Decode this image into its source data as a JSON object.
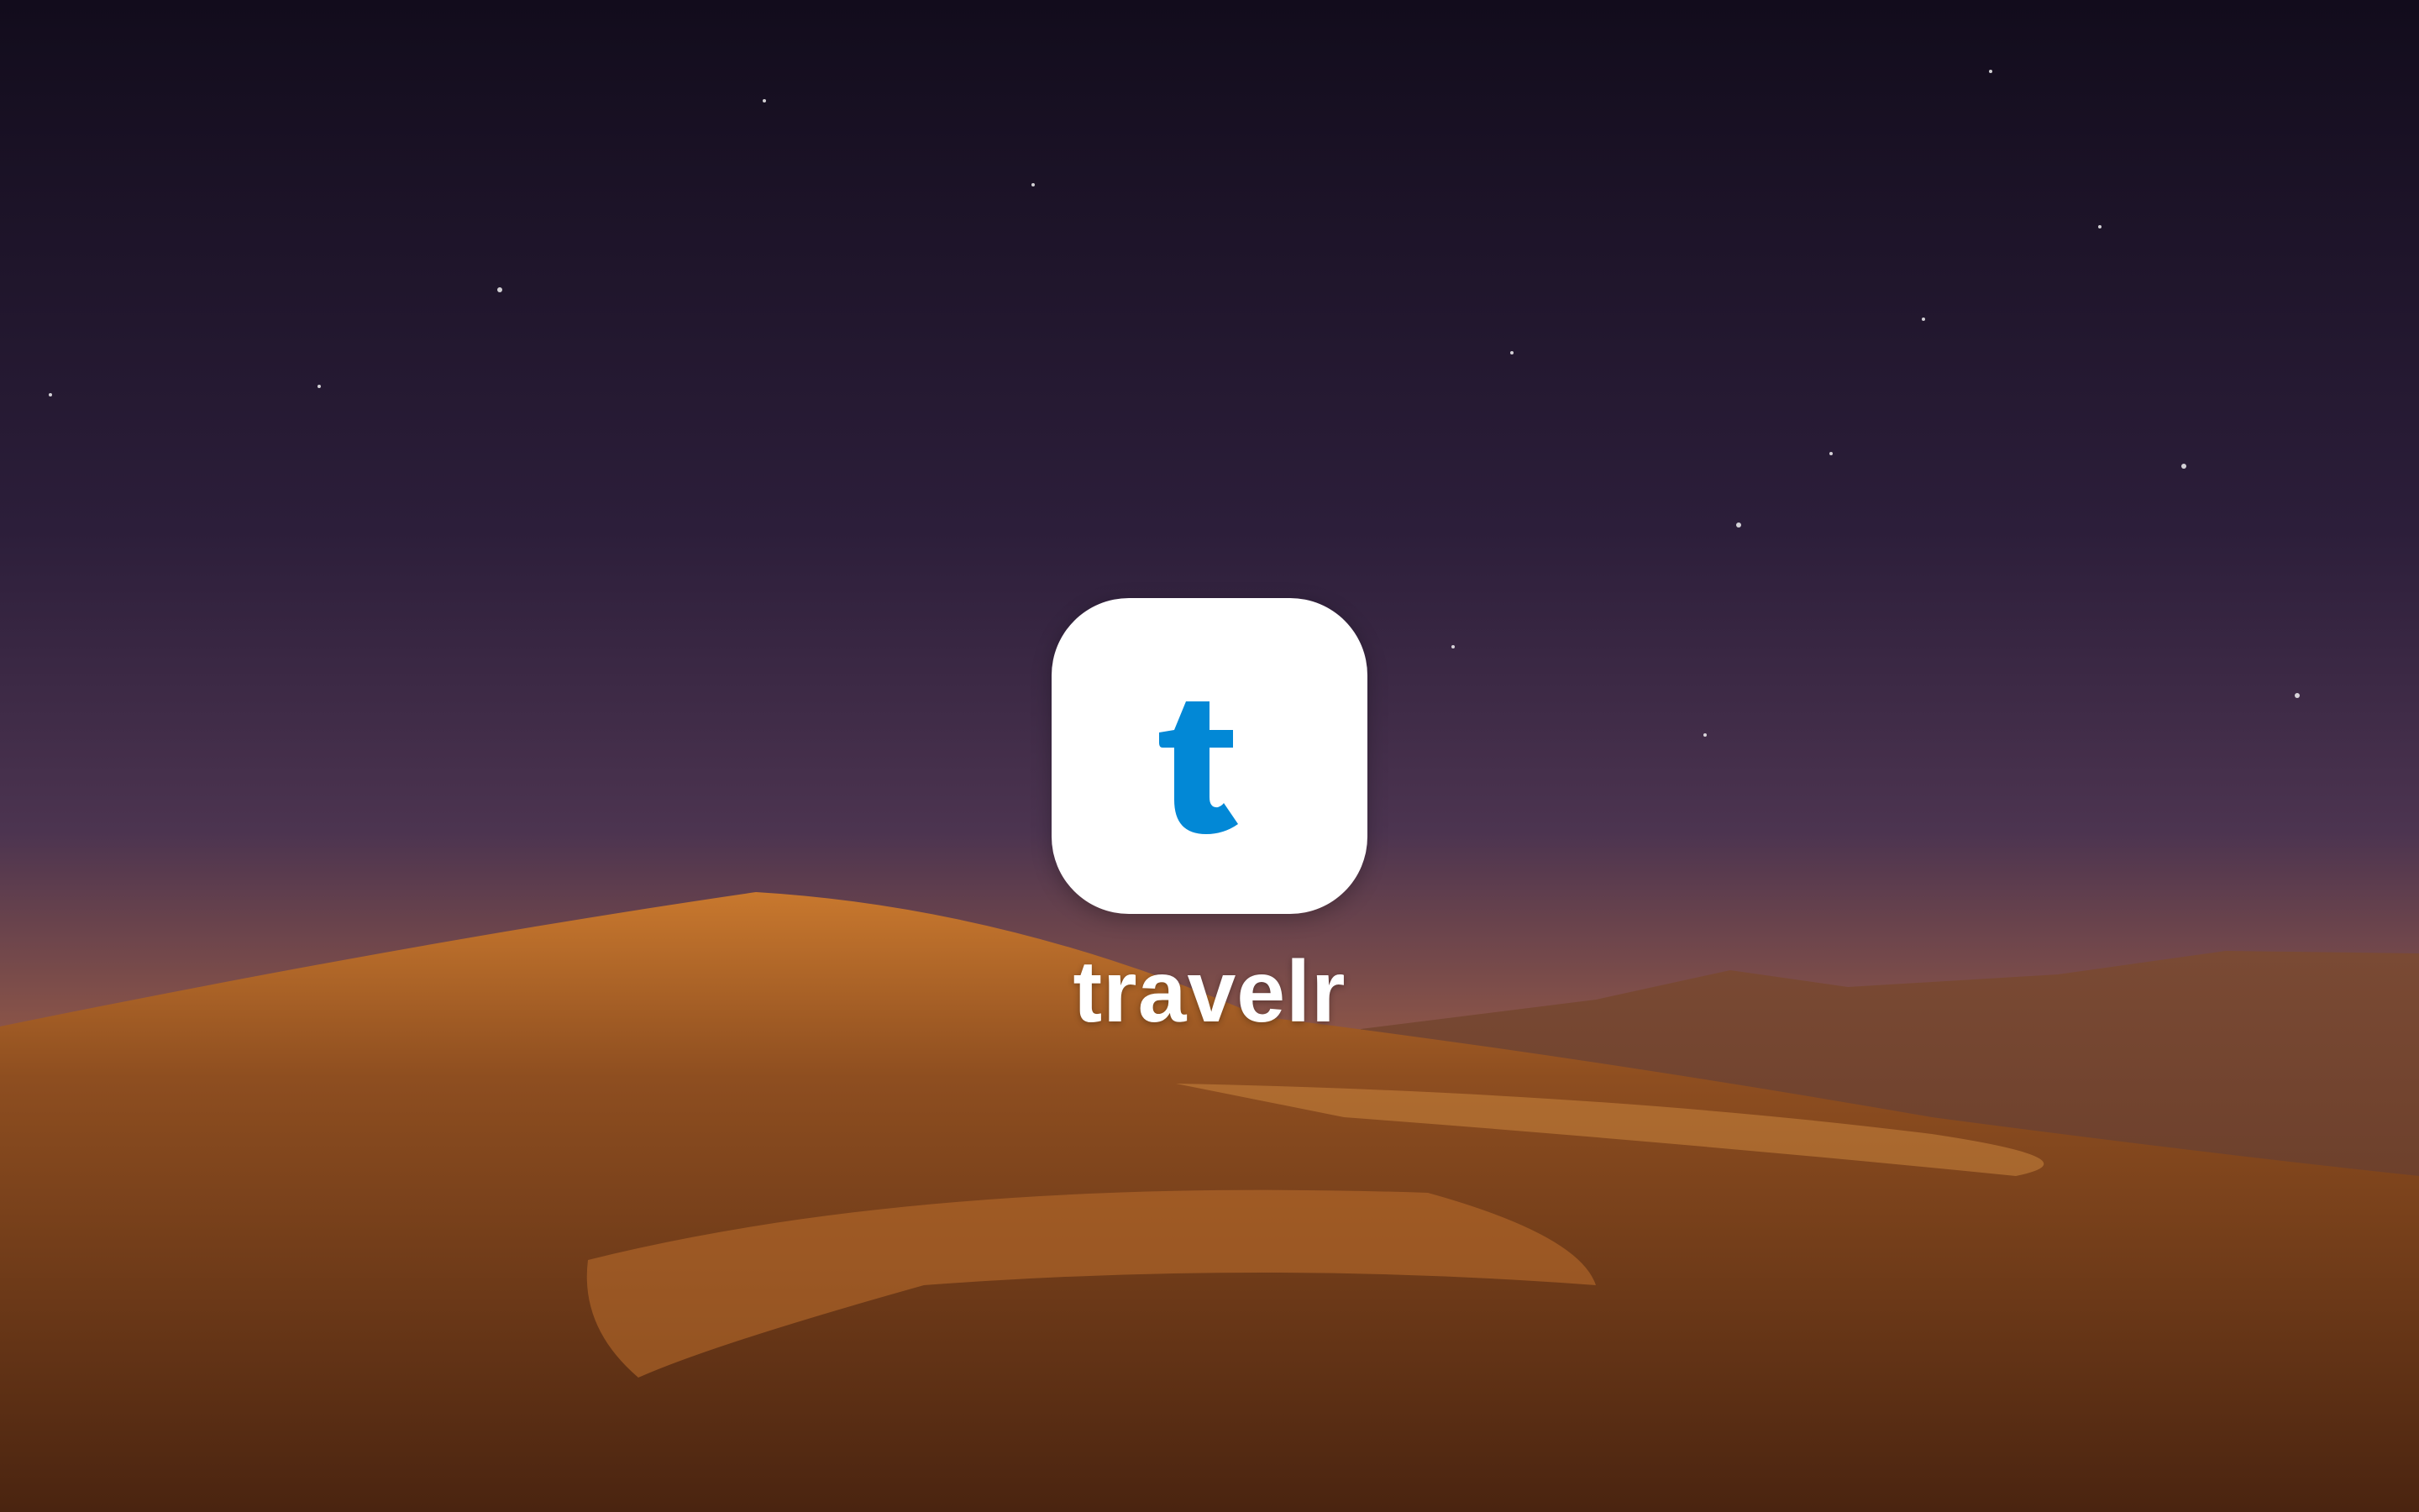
{
  "app": {
    "name": "travelr",
    "icon_letter": "t",
    "icon_name": "travelr-logo-icon",
    "accent_color": "#0288d6"
  },
  "background": {
    "sky_top": "#130d1e",
    "sky_mid": "#3e2a48",
    "horizon": "#b8643a",
    "sand": "#8a4a1e"
  }
}
